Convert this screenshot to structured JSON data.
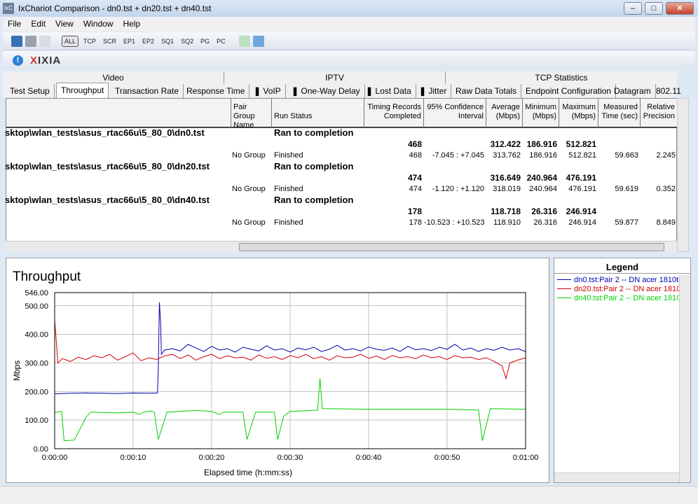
{
  "window": {
    "title": "IxChariot Comparison - dn0.tst + dn20.tst + dn40.tst",
    "app_icon": "IxC"
  },
  "menu": [
    "File",
    "Edit",
    "View",
    "Window",
    "Help"
  ],
  "toolbar": {
    "filters": [
      "ALL",
      "TCP",
      "SCR",
      "EP1",
      "EP2",
      "SQ1",
      "SQ2",
      "PG",
      "PC"
    ],
    "selected": "ALL"
  },
  "brand": {
    "logo": "IXIA"
  },
  "tab_groups": [
    "Video",
    "IPTV",
    "TCP Statistics"
  ],
  "tabs": [
    "Test Setup",
    "Throughput",
    "Transaction Rate",
    "Response Time",
    "VoIP",
    "One-Way Delay",
    "Lost Data",
    "Jitter",
    "Raw Data Totals",
    "Endpoint Configuration",
    "Datagram",
    "802.11"
  ],
  "active_tab": "Throughput",
  "table": {
    "headers": [
      "Pair Group Name",
      "Run Status",
      "Timing Records Completed",
      "95% Confidence Interval",
      "Average (Mbps)",
      "Minimum (Mbps)",
      "Maximum (Mbps)",
      "Measured Time (sec)",
      "Relative Precision"
    ],
    "tests": [
      {
        "file": "sktop\\wlan_tests\\asus_rtac66u\\5_80_0\\dn0.tst",
        "status": "Ran to completion",
        "records": "468",
        "avg": "312.422",
        "min": "186.916",
        "max": "512.821",
        "pair": {
          "group": "No Group",
          "status": "Finished",
          "records": "468",
          "ci": "-7.045 : +7.045",
          "avg": "313.762",
          "min": "186.916",
          "max": "512.821",
          "time": "59.663",
          "precision": "2.245"
        }
      },
      {
        "file": "sktop\\wlan_tests\\asus_rtac66u\\5_80_0\\dn20.tst",
        "status": "Ran to completion",
        "records": "474",
        "avg": "316.649",
        "min": "240.964",
        "max": "476.191",
        "pair": {
          "group": "No Group",
          "status": "Finished",
          "records": "474",
          "ci": "-1.120 : +1.120",
          "avg": "318.019",
          "min": "240.964",
          "max": "476.191",
          "time": "59.619",
          "precision": "0.352"
        }
      },
      {
        "file": "sktop\\wlan_tests\\asus_rtac66u\\5_80_0\\dn40.tst",
        "status": "Ran to completion",
        "records": "178",
        "avg": "118.718",
        "min": "26.316",
        "max": "246.914",
        "pair": {
          "group": "No Group",
          "status": "Finished",
          "records": "178",
          "ci": "-10.523 : +10.523",
          "avg": "118.910",
          "min": "26.316",
          "max": "246.914",
          "time": "59.877",
          "precision": "8.849"
        }
      }
    ]
  },
  "legend": {
    "title": "Legend",
    "entries": [
      {
        "label": "dn0.tst:Pair 2 -- DN acer 1810t",
        "color": "#0000b0"
      },
      {
        "label": "dn20.tst:Pair 2 -- DN acer 1810",
        "color": "#d00000"
      },
      {
        "label": "dn40.tst:Pair 2 -- DN acer 1810",
        "color": "#00d000"
      }
    ]
  },
  "chart_data": {
    "type": "line",
    "title": "Throughput",
    "xlabel": "Elapsed time (h:mm:ss)",
    "ylabel": "Mbps",
    "xlim": [
      "0:00:00",
      "0:01:00"
    ],
    "ylim": [
      0,
      546
    ],
    "grid": true,
    "xticks": [
      "0:00:00",
      "0:00:10",
      "0:00:20",
      "0:00:30",
      "0:00:40",
      "0:00:50",
      "0:01:00"
    ],
    "yticks": [
      "0.00",
      "100.00",
      "200.00",
      "300.00",
      "400.00",
      "500.00",
      "546.00"
    ],
    "series": [
      {
        "name": "dn0.tst:Pair 2 -- DN acer 1810t",
        "color": "#0000b0",
        "x": [
          "0:00:00",
          "0:00:02",
          "0:00:04",
          "0:00:06",
          "0:00:08",
          "0:00:10",
          "0:00:12",
          "0:00:13.1",
          "0:00:13.2",
          "0:00:13.35",
          "0:00:13.5",
          "0:00:13.6",
          "0:00:14",
          "0:00:15",
          "0:00:16",
          "0:00:17",
          "0:00:18",
          "0:00:19",
          "0:00:20",
          "0:00:21",
          "0:00:22",
          "0:00:23",
          "0:00:24",
          "0:00:25",
          "0:00:26",
          "0:00:27",
          "0:00:28",
          "0:00:29",
          "0:00:30",
          "0:00:31",
          "0:00:32",
          "0:00:33",
          "0:00:34",
          "0:00:35",
          "0:00:36",
          "0:00:37",
          "0:00:38",
          "0:00:39",
          "0:00:40",
          "0:00:41",
          "0:00:42",
          "0:00:43",
          "0:00:44",
          "0:00:45",
          "0:00:46",
          "0:00:47",
          "0:00:48",
          "0:00:49",
          "0:00:50",
          "0:00:51",
          "0:00:52",
          "0:00:53",
          "0:00:54",
          "0:00:55",
          "0:00:56",
          "0:00:57",
          "0:00:58",
          "0:00:59",
          "0:01:00"
        ],
        "y": [
          192,
          194,
          195,
          194,
          193,
          195,
          194,
          195,
          270,
          512,
          440,
          330,
          345,
          350,
          342,
          365,
          352,
          340,
          358,
          345,
          350,
          338,
          355,
          348,
          342,
          360,
          345,
          350,
          338,
          352,
          346,
          355,
          340,
          348,
          362,
          345,
          350,
          342,
          356,
          348,
          344,
          352,
          340,
          358,
          346,
          350,
          343,
          355,
          348,
          365,
          345,
          352,
          340,
          350,
          344,
          355,
          345,
          350,
          340
        ]
      },
      {
        "name": "dn20.tst:Pair 2 -- DN acer 1810",
        "color": "#d00000",
        "x": [
          "0:00:00",
          "0:00:00.2",
          "0:00:00.4",
          "0:00:01",
          "0:00:02",
          "0:00:03",
          "0:00:04",
          "0:00:05",
          "0:00:06",
          "0:00:07",
          "0:00:08",
          "0:00:09",
          "0:00:10",
          "0:00:11",
          "0:00:12",
          "0:00:13",
          "0:00:14",
          "0:00:15",
          "0:00:16",
          "0:00:17",
          "0:00:18",
          "0:00:19",
          "0:00:20",
          "0:00:21",
          "0:00:22",
          "0:00:23",
          "0:00:24",
          "0:00:25",
          "0:00:26",
          "0:00:27",
          "0:00:28",
          "0:00:29",
          "0:00:30",
          "0:00:31",
          "0:00:32",
          "0:00:33",
          "0:00:34",
          "0:00:35",
          "0:00:36",
          "0:00:37",
          "0:00:38",
          "0:00:39",
          "0:00:40",
          "0:00:41",
          "0:00:42",
          "0:00:43",
          "0:00:44",
          "0:00:45",
          "0:00:46",
          "0:00:47",
          "0:00:48",
          "0:00:49",
          "0:00:50",
          "0:00:51",
          "0:00:52",
          "0:00:53",
          "0:00:54",
          "0:00:55",
          "0:00:56",
          "0:00:57",
          "0:00:57.5",
          "0:00:58",
          "0:00:59",
          "0:01:00"
        ],
        "y": [
          450,
          380,
          300,
          315,
          305,
          320,
          312,
          325,
          318,
          330,
          310,
          322,
          335,
          308,
          318,
          312,
          325,
          330,
          315,
          328,
          310,
          322,
          330,
          315,
          325,
          318,
          320,
          310,
          328,
          316,
          322,
          312,
          326,
          318,
          330,
          315,
          322,
          310,
          325,
          318,
          320,
          330,
          316,
          324,
          312,
          326,
          318,
          322,
          315,
          328,
          318,
          322,
          312,
          326,
          318,
          320,
          312,
          318,
          305,
          290,
          245,
          300,
          310,
          318
        ]
      },
      {
        "name": "dn40.tst:Pair 2 -- DN acer 1810",
        "color": "#00d000",
        "x": [
          "0:00:00",
          "0:00:00.7",
          "0:00:00.9",
          "0:00:01.2",
          "0:00:02.5",
          "0:00:04",
          "0:00:04.6",
          "0:00:08",
          "0:00:10",
          "0:00:10.8",
          "0:00:11.3",
          "0:00:12.3",
          "0:00:12.7",
          "0:00:13.2",
          "0:00:14.3",
          "0:00:18",
          "0:00:20",
          "0:00:21",
          "0:00:21.5",
          "0:00:24",
          "0:00:24.5",
          "0:00:25.6",
          "0:00:28",
          "0:00:28.4",
          "0:00:29.2",
          "0:00:30",
          "0:00:33.5",
          "0:00:33.8",
          "0:00:34.1",
          "0:00:40",
          "0:00:50",
          "0:00:54",
          "0:00:54.5",
          "0:00:55.5",
          "0:01:00"
        ],
        "y": [
          126,
          130,
          130,
          28,
          30,
          110,
          128,
          125,
          128,
          120,
          128,
          132,
          128,
          32,
          128,
          134,
          130,
          120,
          128,
          128,
          32,
          128,
          128,
          32,
          115,
          130,
          135,
          246,
          140,
          138,
          138,
          135,
          28,
          140,
          138
        ]
      }
    ]
  }
}
